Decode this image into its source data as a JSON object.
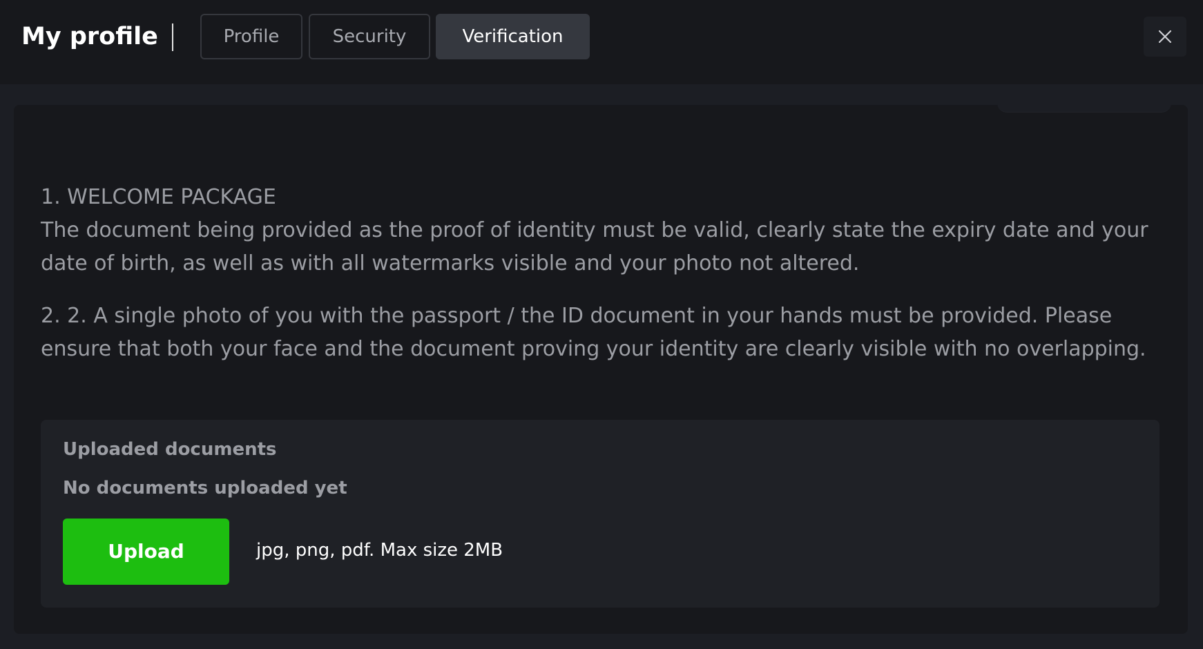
{
  "header": {
    "title": "My profile",
    "tabs": [
      {
        "label": "Profile",
        "active": false
      },
      {
        "label": "Security",
        "active": false
      },
      {
        "label": "Verification",
        "active": true
      }
    ],
    "close_icon": "close-icon"
  },
  "instructions": [
    {
      "heading": "1. WELCOME PACKAGE",
      "text": "The document being provided as the proof of identity must be valid, clearly state the expiry date and your date of birth, as well as with all watermarks visible and your photo not altered."
    },
    {
      "text": "2. 2. A single photo of you with the passport / the ID document in your hands must be provided. Please ensure that both your face and the document proving your identity are clearly visible with no overlapping."
    }
  ],
  "upload": {
    "title": "Uploaded documents",
    "status": "No documents uploaded yet",
    "button_label": "Upload",
    "hint": "jpg, png, pdf. Max size 2MB"
  },
  "colors": {
    "background": "#1c1e24",
    "header": "#17181c",
    "active_tab": "#35383f",
    "accent_green": "#1dbe10",
    "muted_text": "#9c9ea4"
  }
}
